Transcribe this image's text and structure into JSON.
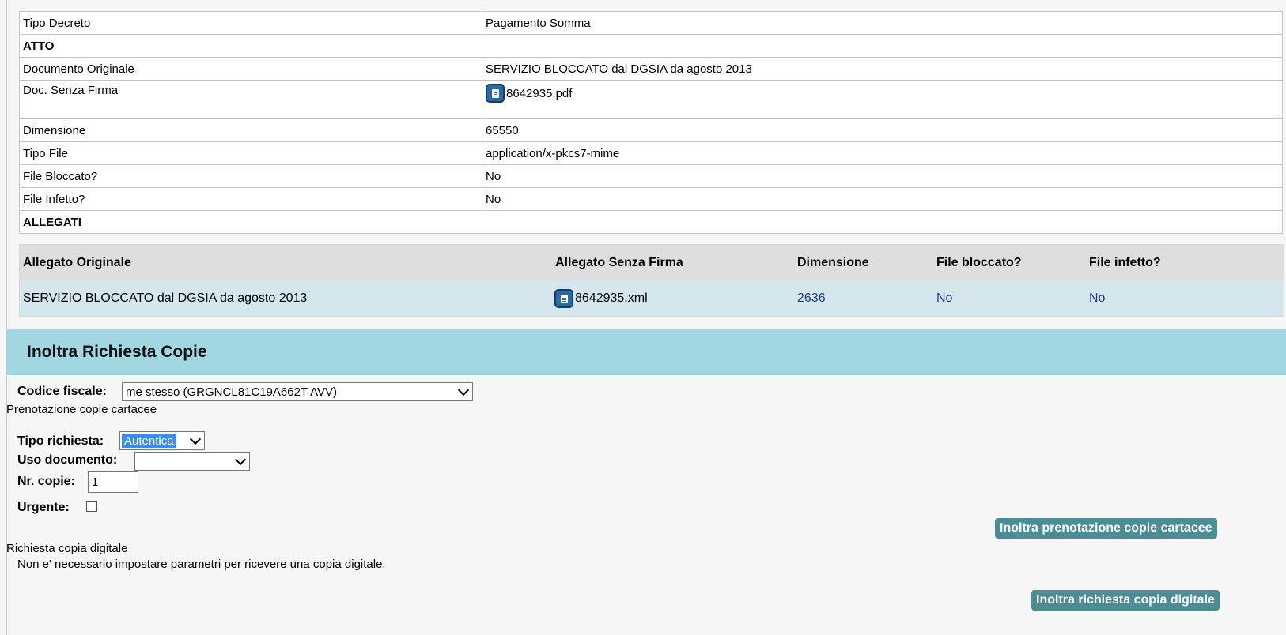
{
  "details": {
    "rows": [
      {
        "label": "Tipo Decreto",
        "value": "Pagamento Somma"
      },
      {
        "label": "ATTO",
        "value": ""
      },
      {
        "label": "Documento Originale",
        "value": "SERVIZIO BLOCCATO dal DGSIA da agosto 2013"
      },
      {
        "label": "Doc. Senza Firma",
        "value": "8642935.pdf"
      },
      {
        "label": "Dimensione",
        "value": "65550"
      },
      {
        "label": "Tipo File",
        "value": "application/x-pkcs7-mime"
      },
      {
        "label": "File Bloccato?",
        "value": "No"
      },
      {
        "label": "File Infetto?",
        "value": "No"
      },
      {
        "label": "ALLEGATI",
        "value": ""
      }
    ]
  },
  "attachments": {
    "headers": [
      "Allegato Originale",
      "Allegato Senza Firma",
      "Dimensione",
      "File bloccato?",
      "File infetto?"
    ],
    "rows": [
      {
        "originale": "SERVIZIO BLOCCATO dal DGSIA da agosto 2013",
        "senza_firma": "8642935.xml",
        "dimensione": "2636",
        "bloccato": "No",
        "infetto": "No"
      }
    ]
  },
  "section": {
    "title": "Inoltra Richiesta Copie"
  },
  "form": {
    "codice_fiscale_label": "Codice fiscale:",
    "codice_fiscale_value": "me stesso (GRGNCL81C19A662T AVV)",
    "prenotazione_heading": "Prenotazione copie cartacee",
    "tipo_richiesta_label": "Tipo richiesta:",
    "tipo_richiesta_value": "Autentica",
    "uso_documento_label": "Uso documento:",
    "uso_documento_value": "",
    "nr_copie_label": "Nr. copie:",
    "nr_copie_value": "1",
    "urgente_label": "Urgente:",
    "btn_prenotazione": "Inoltra prenotazione copie cartacee",
    "digitale_heading": "Richiesta copia digitale",
    "digitale_note": "Non e' necessario impostare parametri per ricevere una copia digitale.",
    "btn_digitale": "Inoltra richiesta copia digitale"
  },
  "colors": {
    "section_bg": "#a2d7e2",
    "button_bg": "#4b8c95",
    "row_highlight": "#d4e7ef"
  },
  "icons": {
    "file": "document-icon"
  }
}
